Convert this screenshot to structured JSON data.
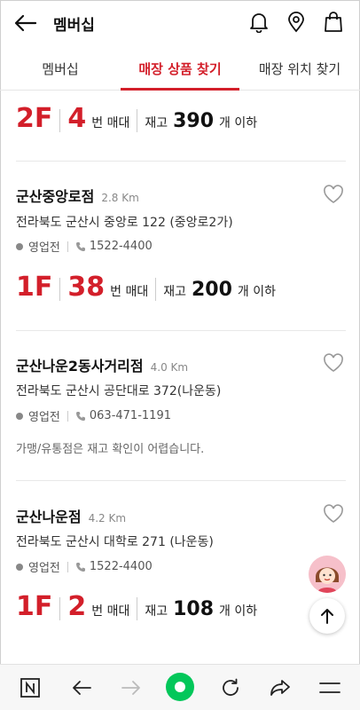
{
  "header": {
    "title": "멤버십",
    "icons": [
      "back-arrow-icon",
      "bell-icon",
      "map-pin-icon",
      "shopping-bag-icon"
    ]
  },
  "tabs": [
    {
      "label": "멤버십",
      "active": false
    },
    {
      "label": "매장 상품 찾기",
      "active": true
    },
    {
      "label": "매장 위치 찾기",
      "active": false
    }
  ],
  "accent_color": "#d31f2a",
  "stores": [
    {
      "floor": "2F",
      "section": "4",
      "section_label": "번 매대",
      "stock_label": "재고",
      "stock": "390",
      "stock_suffix": "개 이하"
    },
    {
      "name": "군산중앙로점",
      "distance": "2.8 Km",
      "address": "전라북도 군산시 중앙로 122 (중앙로2가)",
      "status": "영업전",
      "phone": "1522-4400",
      "floor": "1F",
      "section": "38",
      "section_label": "번 매대",
      "stock_label": "재고",
      "stock": "200",
      "stock_suffix": "개 이하"
    },
    {
      "name": "군산나운2동사거리점",
      "distance": "4.0 Km",
      "address": "전라북도 군산시 공단대로 372(나운동)",
      "status": "영업전",
      "phone": "063-471-1191",
      "notice": "가맹/유통점은 재고 확인이 어렵습니다."
    },
    {
      "name": "군산나운점",
      "distance": "4.2 Km",
      "address": "전라북도 군산시 대학로 271 (나운동)",
      "status": "영업전",
      "phone": "1522-4400",
      "floor": "1F",
      "section": "2",
      "section_label": "번 매대",
      "stock_label": "재고",
      "stock": "108",
      "stock_suffix": "개 이하"
    }
  ],
  "bottom_bar": {
    "icons": [
      "naver-n-icon",
      "back-arrow-icon",
      "forward-arrow-icon",
      "home-circle-icon",
      "refresh-icon",
      "share-icon",
      "menu-icon"
    ]
  }
}
